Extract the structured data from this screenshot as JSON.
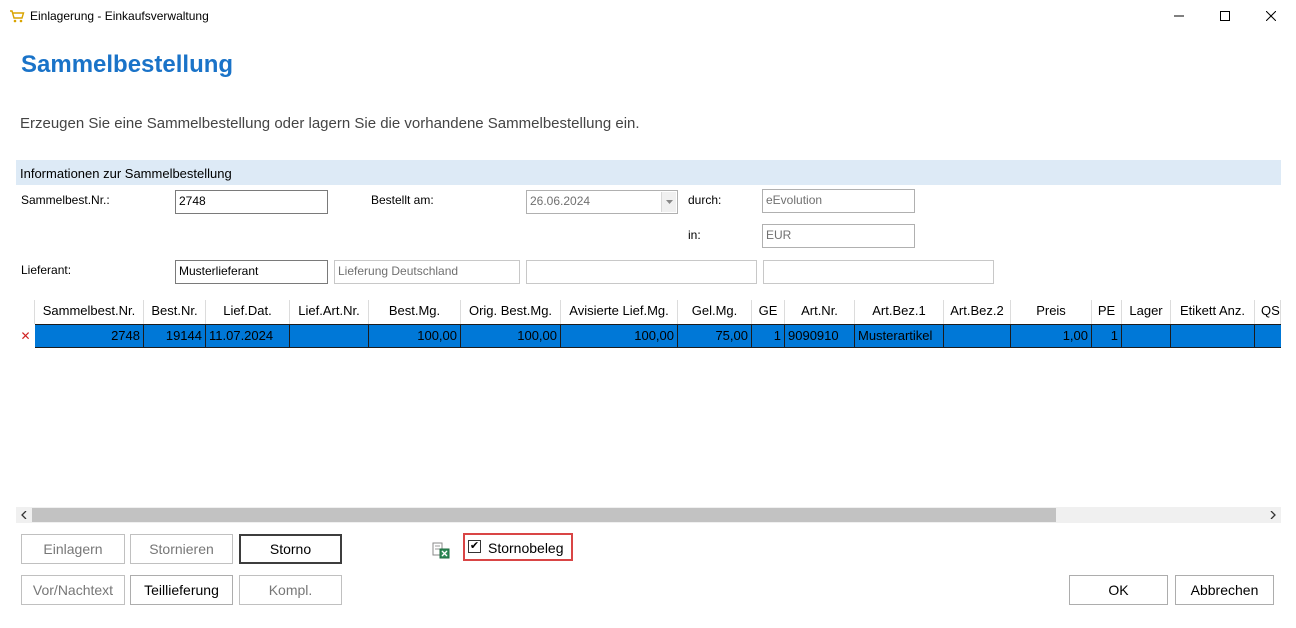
{
  "window": {
    "title": "Einlagerung - Einkaufsverwaltung"
  },
  "header": {
    "title": "Sammelbestellung",
    "subtitle": "Erzeugen Sie eine Sammelbestellung oder lagern Sie die vorhandene Sammelbestellung ein."
  },
  "info": {
    "section_title": "Informationen zur Sammelbestellung",
    "sammelbest_label": "Sammelbest.Nr.:",
    "sammelbest_value": "2748",
    "bestellt_label": "Bestellt am:",
    "bestellt_value": "26.06.2024",
    "durch_label": "durch:",
    "durch_value": "eEvolution",
    "in_label": "in:",
    "in_value": "EUR",
    "lieferant_label": "Lieferant:",
    "lieferant_value": "Musterlieferant",
    "lieferung_value": "Lieferung Deutschland",
    "extra1_value": "",
    "extra2_value": ""
  },
  "grid": {
    "columns": [
      "Sammelbest.Nr.",
      "Best.Nr.",
      "Lief.Dat.",
      "Lief.Art.Nr.",
      "Best.Mg.",
      "Orig. Best.Mg.",
      "Avisierte Lief.Mg.",
      "Gel.Mg.",
      "GE",
      "Art.Nr.",
      "Art.Bez.1",
      "Art.Bez.2",
      "Preis",
      "PE",
      "Lager",
      "Etikett Anz.",
      "QS"
    ],
    "rows": [
      [
        "2748",
        "19144",
        "11.07.2024",
        "",
        "100,00",
        "100,00",
        "100,00",
        "75,00",
        "1",
        "9090910",
        "Musterartikel",
        "",
        "1,00",
        "1",
        "",
        "",
        ""
      ]
    ]
  },
  "buttons": {
    "einlagern": "Einlagern",
    "stornieren": "Stornieren",
    "storno": "Storno",
    "vor_nachtext": "Vor/Nachtext",
    "teillieferung": "Teillieferung",
    "kompl": "Kompl.",
    "ok": "OK",
    "abbrechen": "Abbrechen"
  },
  "stornobeleg": {
    "label": "Stornobeleg",
    "checked": true
  },
  "colors": {
    "accent": "#1a73c8",
    "selection": "#0078d7",
    "section_bg": "#ddeaf6",
    "highlight_border": "#d94545"
  }
}
